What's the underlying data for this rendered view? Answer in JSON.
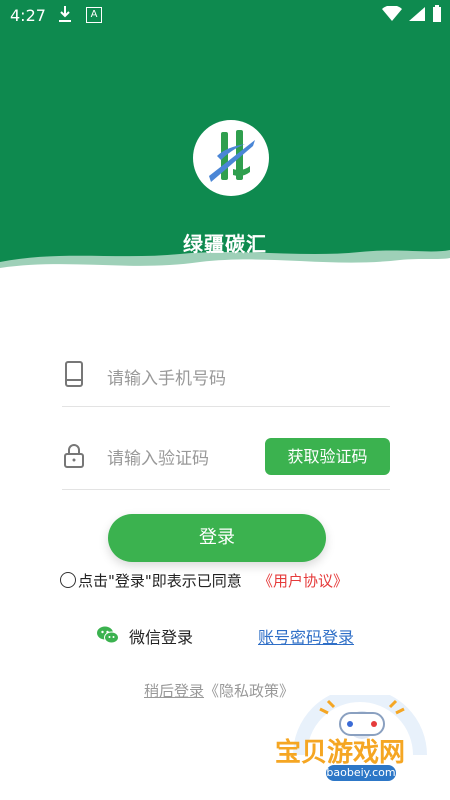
{
  "status_bar": {
    "time": "4:27",
    "download_icon": "download-icon",
    "accessibility_icon": "a-icon"
  },
  "header": {
    "app_title": "绿疆碳汇",
    "logo_icon": "app-logo-icon"
  },
  "form": {
    "phone_placeholder": "请输入手机号码",
    "code_placeholder": "请输入验证码",
    "get_code_label": "获取验证码",
    "login_label": "登录"
  },
  "agreement": {
    "text": "点击\"登录\"即表示已同意",
    "link": "《用户协议》"
  },
  "alt_login": {
    "wechat_label": "微信登录",
    "password_login": "账号密码登录"
  },
  "later": {
    "text": "稍后登录",
    "privacy": "《隐私政策》"
  },
  "watermark": {
    "brand": "宝贝游戏网",
    "url": "baobeiy.com"
  },
  "colors": {
    "header_green": "#0e8a4f",
    "button_green": "#3bb24f",
    "agreement_red": "#e53b3b",
    "link_blue": "#2f6fc7"
  }
}
